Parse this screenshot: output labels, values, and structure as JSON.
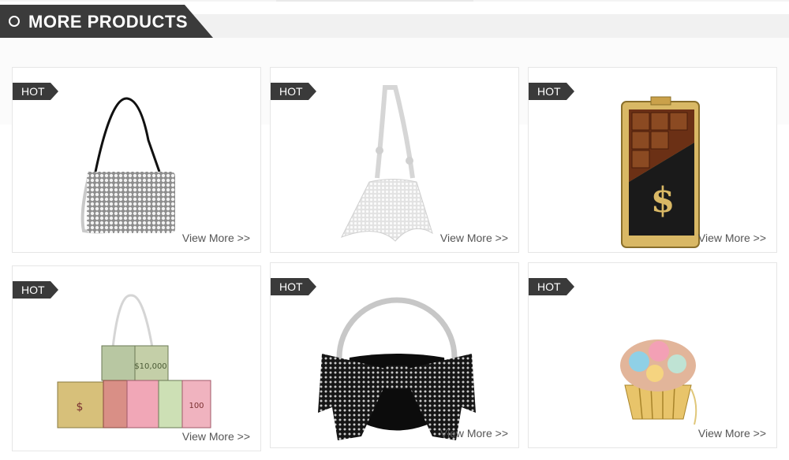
{
  "section": {
    "title": "MORE PRODUCTS",
    "icon": "circle-icon"
  },
  "badge_text": "HOT",
  "products": [
    {
      "badge": "HOT",
      "link": "View More >>",
      "image": "rhinestone-shoulder-bag"
    },
    {
      "badge": "HOT",
      "link": "View More >>",
      "image": "crystal-hobo-bag"
    },
    {
      "badge": "HOT",
      "link": "View More >>",
      "image": "chocolate-bar-clutch"
    },
    {
      "badge": "HOT",
      "link": "View More >>",
      "image": "money-stack-clutches"
    },
    {
      "badge": "HOT",
      "link": "View More >>",
      "image": "bow-ring-handle-bag"
    },
    {
      "badge": "HOT",
      "link": "View More >>",
      "image": "cupcake-crystal-clutch"
    }
  ],
  "colors": {
    "tab": "#3b3b3b",
    "badge": "#3a3a3a",
    "band": "#f1f1f1"
  }
}
